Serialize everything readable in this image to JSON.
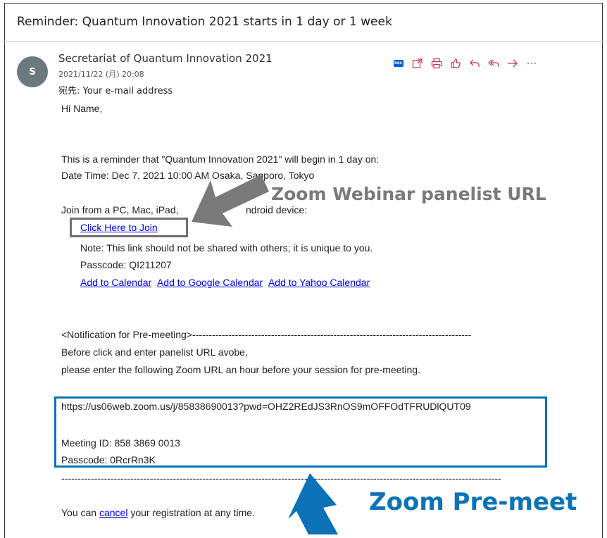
{
  "subject": {
    "prefix": "Reminder: Quantum Innovation 2021 starts in 1 day",
    "suffix": " or 1 week"
  },
  "sender": {
    "avatar_letter": "S",
    "name": "Secretariat of Quantum Innovation 2021",
    "datetime": "2021/11/22 (月) 20:08",
    "to_label": "宛先:",
    "to_value": "Your e-mail address"
  },
  "toolbar": {
    "box_label": "box"
  },
  "body": {
    "greeting": "Hi Name,",
    "line1": "This is a reminder that \"Quantum Innovation 2021\" will begin in 1 day on:",
    "line2": "Date Time: Dec 7, 2021 10:00 AM Osaka, Sapporo, Tokyo",
    "join_a": "Join from a PC, Mac, iPad,",
    "join_b": "ndroid device:",
    "join_link": "Click Here to Join",
    "note": "Note: This link should not be shared with others; it is unique to you.",
    "passcode1": "Passcode: QI211207",
    "cal1": "Add to Calendar",
    "cal2": "Add to Google Calendar",
    "cal3": "Add to Yahoo Calendar",
    "notif": "<Notification for Pre-meeting>-------------------------------------------------------------------------------------",
    "before": "Before click and enter panelist URL avobe,",
    "please": "please enter the following Zoom URL an hour before your session for pre-meeting.",
    "url": "https://us06web.zoom.us/j/85838690013?pwd=OHZ2REdJS3RnOS9mOFFOdTFRUDlQUT09",
    "meeting_id": "Meeting ID: 858 3869 0013",
    "passcode2": "Passcode: 0RcrRn3K",
    "dashes": "--------------------------------------------------------------------------------------------------------------------------------------",
    "cancel_pre": "You can ",
    "cancel_link": "cancel",
    "cancel_post": " your registration at any time."
  },
  "annotations": {
    "gray_label": "Zoom Webinar panelist URL",
    "blue_label": "Zoom Pre-meet"
  },
  "colors": {
    "gray": "#7a7a7a",
    "blue": "#0b72b8",
    "toolbar_icon": "#c4314b"
  }
}
